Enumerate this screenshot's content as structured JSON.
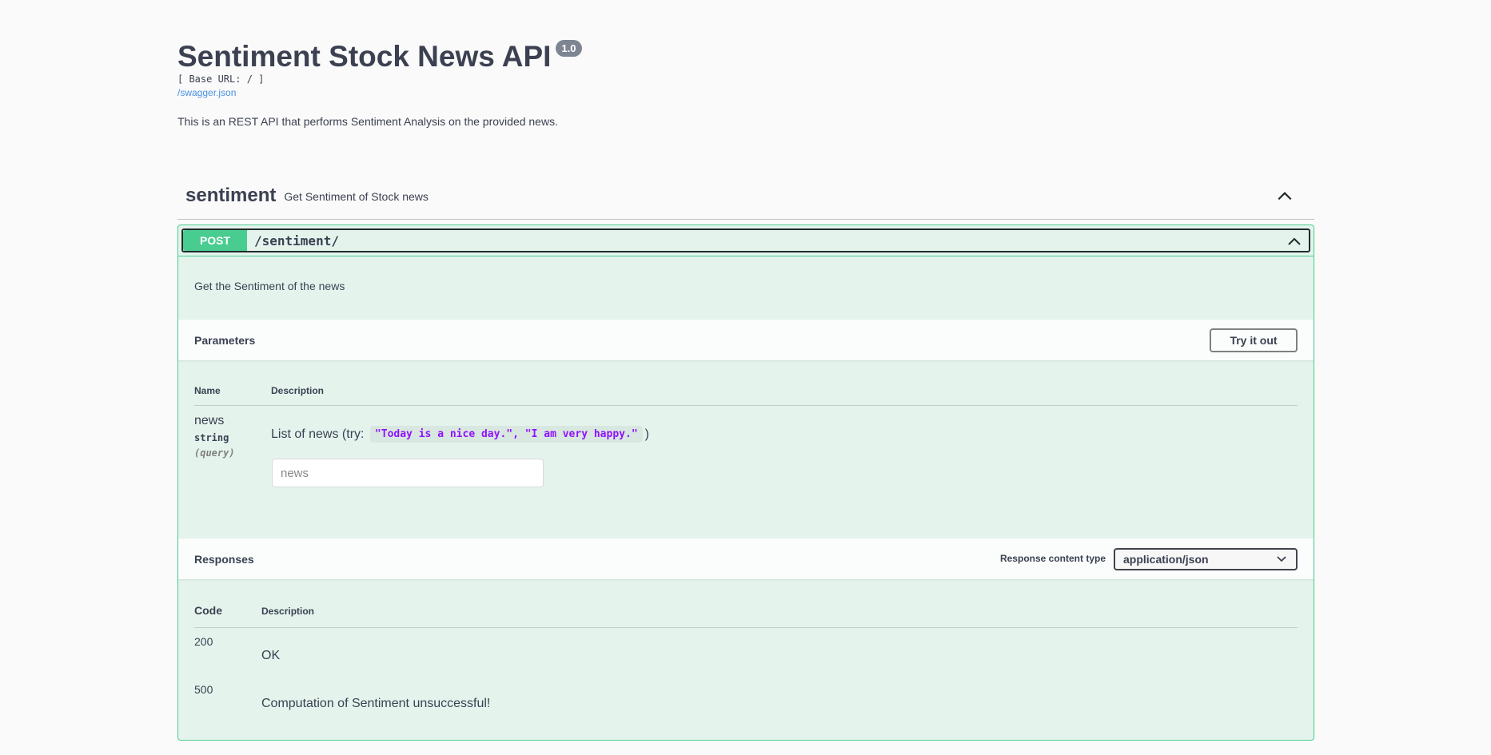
{
  "info": {
    "title": "Sentiment Stock News API",
    "version": "1.0",
    "base_url": "[ Base URL: / ]",
    "spec_link": "/swagger.json",
    "description": "This is an REST API that performs Sentiment Analysis on the provided news."
  },
  "tag": {
    "name": "sentiment",
    "description": "Get Sentiment of Stock news",
    "toggle_icon": "chevron-up-icon"
  },
  "operation": {
    "method": "POST",
    "path": "/sentiment/",
    "description": "Get the Sentiment of the news",
    "parameters": {
      "title": "Parameters",
      "try_button": "Try it out",
      "col_name": "Name",
      "col_description": "Description",
      "items": [
        {
          "name": "news",
          "type": "string",
          "in": "(query)",
          "description_prefix": "List of news (try: ",
          "example": "\"Today is a nice day.\", \"I am very happy.\"",
          "description_suffix": ")",
          "placeholder": "news"
        }
      ]
    },
    "responses": {
      "title": "Responses",
      "content_type_label": "Response content type",
      "content_type_value": "application/json",
      "col_code": "Code",
      "col_description": "Description",
      "items": [
        {
          "code": "200",
          "description": "OK"
        },
        {
          "code": "500",
          "description": "Computation of Sentiment unsuccessful!"
        }
      ]
    }
  },
  "colors": {
    "post_green": "#49cc90",
    "text": "#3b4151",
    "link": "#4990e2",
    "example_purple": "#9012fe"
  }
}
